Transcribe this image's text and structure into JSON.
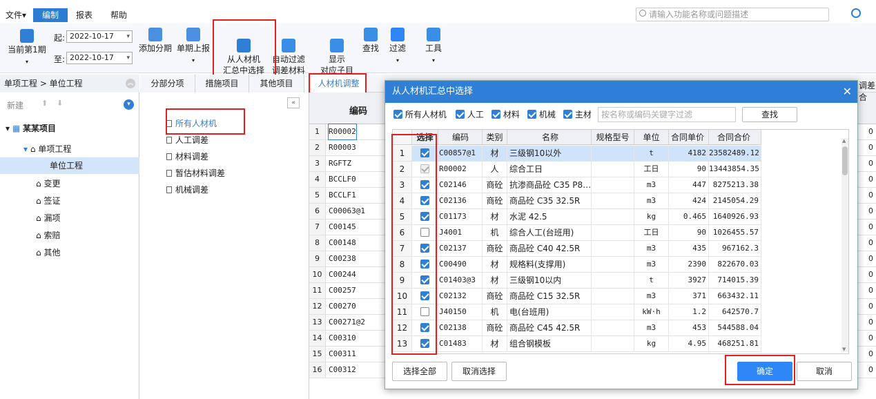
{
  "menubar": {
    "items": [
      "文件▾",
      "编制",
      "报表",
      "帮助"
    ],
    "search_placeholder": "请输入功能名称或问题描述"
  },
  "ribbon": {
    "current_period": "当前第1期",
    "start_label": "起:",
    "start_date": "2022-10-17",
    "end_label": "至:",
    "end_date": "2022-10-17",
    "buttons": [
      "添加分期",
      "单期上报",
      "从人材机\n汇总中选择",
      "自动过滤\n调差材料",
      "显示\n对应子目",
      "查找",
      "过滤",
      "工具"
    ]
  },
  "left": {
    "breadcrumb": "单项工程 > 单位工程",
    "new_label": "新建",
    "tree": [
      "某某项目",
      "单项工程",
      "单位工程",
      "变更",
      "签证",
      "漏项",
      "索赔",
      "其他"
    ]
  },
  "middle": {
    "tabs": [
      "分部分项",
      "措施项目",
      "其他项目",
      "人材机调整"
    ],
    "list": [
      "所有人材机",
      "人工调差",
      "材料调差",
      "暂估材料调差",
      "机械调差"
    ]
  },
  "grid": {
    "header": "编码",
    "right_header": "调差合",
    "rows": [
      {
        "n": "1",
        "code": "R00002"
      },
      {
        "n": "2",
        "code": "R00003"
      },
      {
        "n": "3",
        "code": "RGFTZ"
      },
      {
        "n": "4",
        "code": "BCCLF0"
      },
      {
        "n": "5",
        "code": "BCCLF1"
      },
      {
        "n": "6",
        "code": "C00063@1"
      },
      {
        "n": "7",
        "code": "C00145"
      },
      {
        "n": "8",
        "code": "C00148"
      },
      {
        "n": "9",
        "code": "C00238"
      },
      {
        "n": "10",
        "code": "C00244"
      },
      {
        "n": "11",
        "code": "C00257"
      },
      {
        "n": "12",
        "code": "C00270"
      },
      {
        "n": "13",
        "code": "C00271@2"
      },
      {
        "n": "14",
        "code": "C00310"
      },
      {
        "n": "15",
        "code": "C00311"
      },
      {
        "n": "16",
        "code": "C00312"
      }
    ]
  },
  "dialog": {
    "title": "从人材机汇总中选择",
    "filters": [
      {
        "label": "所有人材机",
        "checked": true
      },
      {
        "label": "人工",
        "checked": true
      },
      {
        "label": "材料",
        "checked": true
      },
      {
        "label": "机械",
        "checked": true
      },
      {
        "label": "主材",
        "checked": true
      }
    ],
    "filter_placeholder": "按名称或编码关键字过滤",
    "find_label": "查找",
    "columns": [
      "",
      "选择",
      "编码",
      "类别",
      "名称",
      "规格型号",
      "单位",
      "合同单价",
      "合同合价"
    ],
    "rows": [
      {
        "n": "1",
        "sel": "on",
        "code": "C00857@1",
        "type": "材",
        "name": "三级钢10以外",
        "spec": "",
        "unit": "t",
        "price": "4182",
        "total": "23582489.12"
      },
      {
        "n": "2",
        "sel": "dis",
        "code": "R00002",
        "type": "人",
        "name": "综合工日",
        "spec": "",
        "unit": "工日",
        "price": "90",
        "total": "13443854.35"
      },
      {
        "n": "3",
        "sel": "on",
        "code": "C02146",
        "type": "商砼",
        "name": "抗渗商品砼 C35 P8…",
        "spec": "",
        "unit": "m3",
        "price": "447",
        "total": "8275213.38"
      },
      {
        "n": "4",
        "sel": "on",
        "code": "C02136",
        "type": "商砼",
        "name": "商品砼 C35 32.5R",
        "spec": "",
        "unit": "m3",
        "price": "424",
        "total": "2145054.29"
      },
      {
        "n": "5",
        "sel": "on",
        "code": "C01173",
        "type": "材",
        "name": "水泥 42.5",
        "spec": "",
        "unit": "kg",
        "price": "0.465",
        "total": "1640926.93"
      },
      {
        "n": "6",
        "sel": "off",
        "code": "J4001",
        "type": "机",
        "name": "综合人工(台班用)",
        "spec": "",
        "unit": "工日",
        "price": "90",
        "total": "1026455.57"
      },
      {
        "n": "7",
        "sel": "on",
        "code": "C02137",
        "type": "商砼",
        "name": "商品砼 C40 42.5R",
        "spec": "",
        "unit": "m3",
        "price": "435",
        "total": "967162.3"
      },
      {
        "n": "8",
        "sel": "on",
        "code": "C00490",
        "type": "材",
        "name": "规格料(支撑用)",
        "spec": "",
        "unit": "m3",
        "price": "2390",
        "total": "822670.03"
      },
      {
        "n": "9",
        "sel": "on",
        "code": "C01403@3",
        "type": "材",
        "name": "三级钢10以内",
        "spec": "",
        "unit": "t",
        "price": "3927",
        "total": "714015.39"
      },
      {
        "n": "10",
        "sel": "on",
        "code": "C02132",
        "type": "商砼",
        "name": "商品砼 C15 32.5R",
        "spec": "",
        "unit": "m3",
        "price": "371",
        "total": "663432.11"
      },
      {
        "n": "11",
        "sel": "off",
        "code": "J40150",
        "type": "机",
        "name": "电(台班用)",
        "spec": "",
        "unit": "kW·h",
        "price": "1.2",
        "total": "642570.7"
      },
      {
        "n": "12",
        "sel": "on",
        "code": "C02138",
        "type": "商砼",
        "name": "商品砼 C45 42.5R",
        "spec": "",
        "unit": "m3",
        "price": "453",
        "total": "544588.04"
      },
      {
        "n": "13",
        "sel": "on",
        "code": "C01483",
        "type": "材",
        "name": "组合钢模板",
        "spec": "",
        "unit": "kg",
        "price": "4.95",
        "total": "468251.81"
      }
    ],
    "select_all": "选择全部",
    "deselect": "取消选择",
    "ok": "确定",
    "cancel": "取消"
  }
}
